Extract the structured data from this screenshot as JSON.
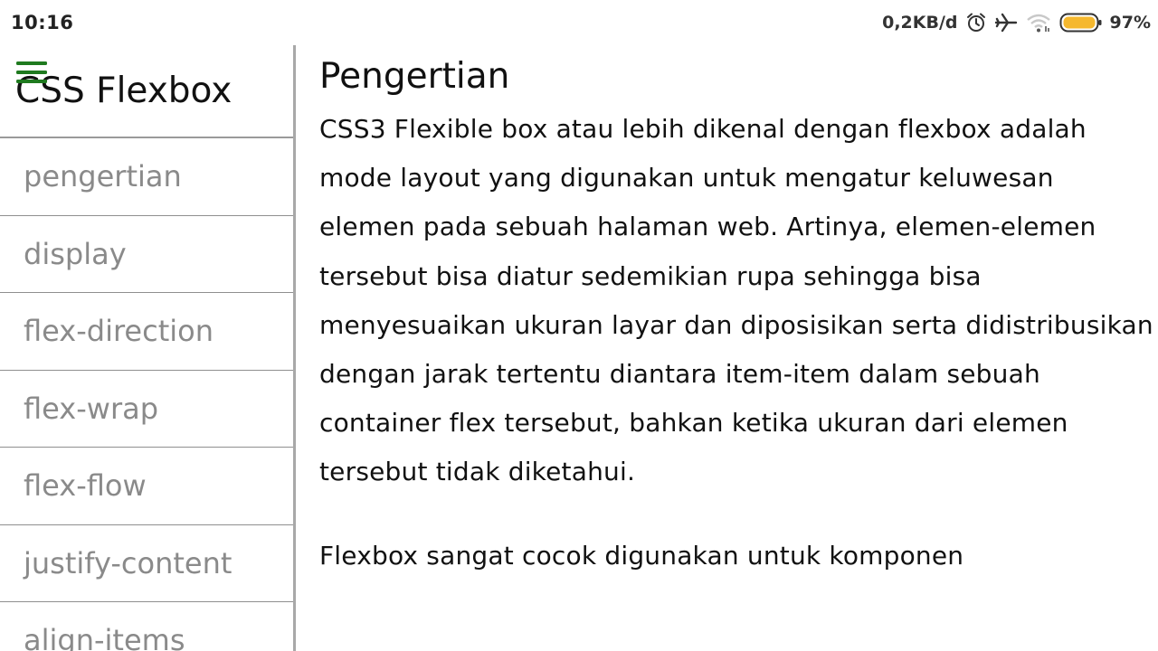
{
  "status_bar": {
    "time": "10:16",
    "net_speed": "0,2KB/d",
    "battery_percent": "97%",
    "icons": [
      "alarm-icon",
      "airplane-mode-icon",
      "wifi-icon",
      "battery-icon"
    ],
    "battery_color": "#f5b82e"
  },
  "sidebar": {
    "title": "CSS Flexbox",
    "menu_icon_color": "#1f7a1f",
    "items": [
      {
        "label": "pengertian"
      },
      {
        "label": "display"
      },
      {
        "label": "flex-direction"
      },
      {
        "label": "flex-wrap"
      },
      {
        "label": "flex-flow"
      },
      {
        "label": "justify-content"
      },
      {
        "label": "align-items"
      }
    ]
  },
  "main": {
    "heading": "Pengertian",
    "paragraphs": [
      "CSS3 Flexible box atau lebih dikenal dengan flexbox adalah mode layout yang digunakan untuk mengatur keluwesan elemen pada sebuah halaman web. Artinya, elemen-elemen tersebut bisa diatur sedemikian rupa sehingga bisa menyesuaikan ukuran layar dan diposisikan serta didistribusikan dengan jarak tertentu diantara item-item dalam sebuah container flex tersebut, bahkan ketika ukuran dari elemen tersebut tidak diketahui.",
      "Flexbox sangat cocok digunakan untuk komponen"
    ]
  }
}
